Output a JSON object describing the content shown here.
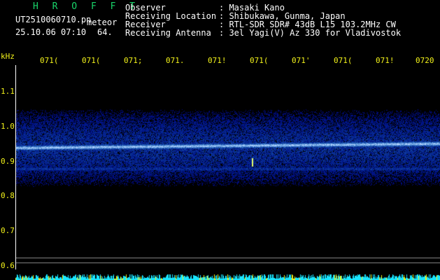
{
  "header": {
    "title": "H R O F F T",
    "filename": "UT2510060710.pn",
    "type": "meteor",
    "datetime": "25.10.06 07:10",
    "count": "64."
  },
  "info": {
    "labels": [
      "Observer",
      "Receiving Location",
      "Receiver",
      "Receiving Antenna"
    ],
    "values": [
      ": Masaki Kano",
      ": Shibukawa, Gunma, Japan",
      ": RTL-SDR SDR# 43dB L15 103.2MHz CW",
      ": 3el Yagi(V) Az 330 for Vladivostok"
    ]
  },
  "time_axis": {
    "ticks": [
      "071(",
      "071(",
      "071;",
      "071.",
      "071!",
      "071(",
      "071'",
      "071(",
      "071!",
      "0720"
    ]
  },
  "freq_axis": {
    "unit": "kHz",
    "ticks": [
      "1.1",
      "1.0",
      "0.9",
      "0.8",
      "0.7",
      "0.6"
    ],
    "min": 0.6,
    "max": 1.1
  },
  "colors": {
    "title": "#19d46a",
    "text": "#ffffff",
    "tick": "#f2f21a",
    "background": "#000000",
    "band": "#3c78ff",
    "noise": "#19e6ff"
  },
  "signal": {
    "main_band_khz": 0.94,
    "faint_band_khz": 0.88,
    "meteor_khz": 0.9
  }
}
